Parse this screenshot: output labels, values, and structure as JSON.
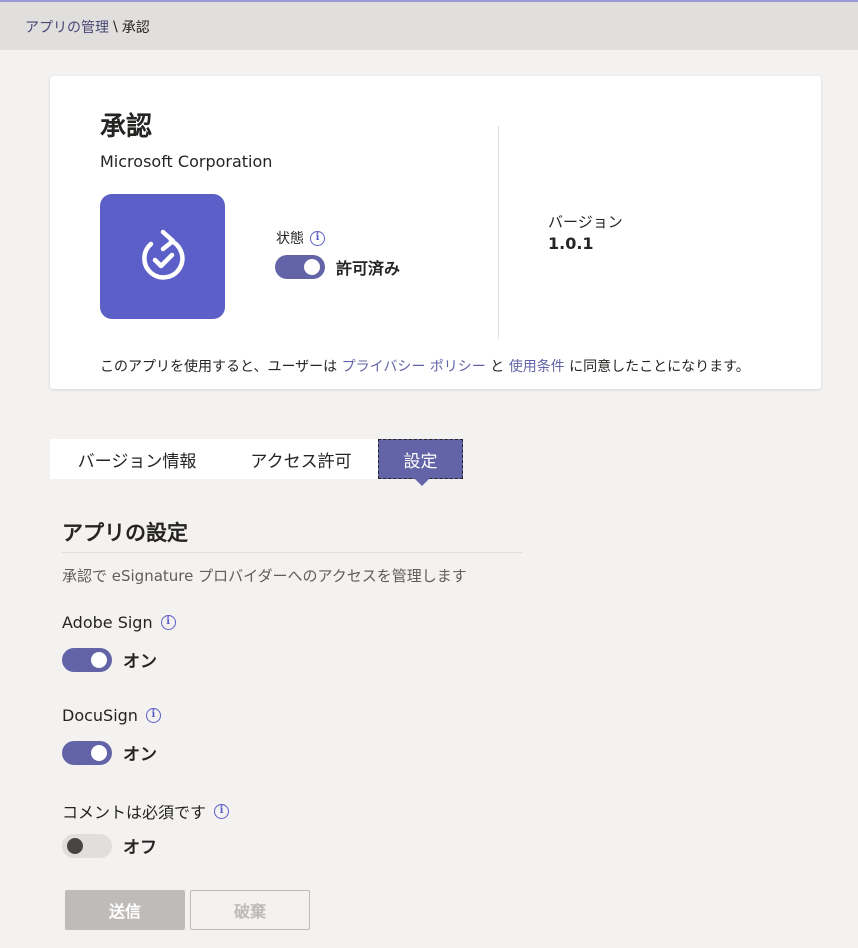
{
  "breadcrumb": {
    "parent": "アプリの管理",
    "separator": "\\",
    "current": "承認"
  },
  "app": {
    "name": "承認",
    "publisher": "Microsoft Corporation",
    "tile_color": "#5b5fc7",
    "icon": "approval-icon",
    "status_label": "状態",
    "status_value": "許可済み",
    "status_on": true,
    "version_label": "バージョン",
    "version_value": "1.0.1"
  },
  "consent": {
    "prefix": "このアプリを使用すると、ユーザーは",
    "privacy_link": "プライバシー ポリシー",
    "and": "と",
    "terms_link": "使用条件",
    "suffix": "に同意したことになります。"
  },
  "tabs": [
    {
      "label": "バージョン情報",
      "selected": false
    },
    {
      "label": "アクセス許可",
      "selected": false
    },
    {
      "label": "設定",
      "selected": true
    }
  ],
  "settings": {
    "title": "アプリの設定",
    "description": "承認で eSignature プロバイダーへのアクセスを管理します",
    "items": [
      {
        "label": "Adobe Sign",
        "value": "オン",
        "on": true
      },
      {
        "label": "DocuSign",
        "value": "オン",
        "on": true
      },
      {
        "label": "コメントは必須です",
        "value": "オフ",
        "on": false
      }
    ]
  },
  "buttons": {
    "submit": "送信",
    "discard": "破棄"
  },
  "colors": {
    "accent": "#6264a7",
    "background": "#f3f2f1"
  }
}
